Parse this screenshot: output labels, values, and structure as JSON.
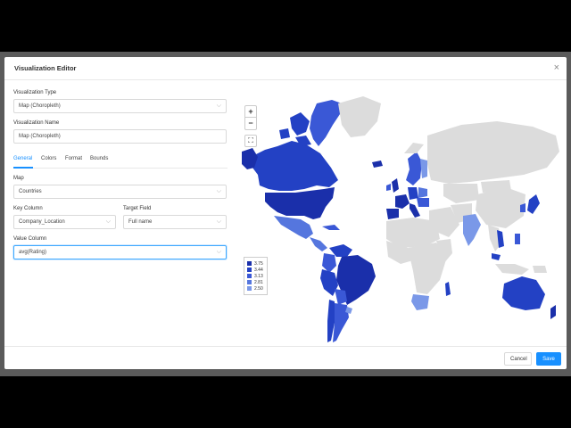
{
  "dialog": {
    "title": "Visualization Editor",
    "close": "×"
  },
  "form": {
    "vis_type_label": "Visualization Type",
    "vis_type_value": "Map (Choropleth)",
    "vis_name_label": "Visualization Name",
    "vis_name_value": "Map (Choropleth)",
    "tabs": [
      "General",
      "Colors",
      "Format",
      "Bounds"
    ],
    "map_label": "Map",
    "map_value": "Countries",
    "key_column_label": "Key Column",
    "key_column_value": "Company_Location",
    "target_field_label": "Target Field",
    "target_field_value": "Full name",
    "value_column_label": "Value Column",
    "value_column_value": "avg(Rating)"
  },
  "map": {
    "zoom_in": "+",
    "zoom_out": "−",
    "fullscreen": "⛶",
    "legend": [
      {
        "label": "3.75",
        "color": "#1a2faa"
      },
      {
        "label": "3.44",
        "color": "#2341c4"
      },
      {
        "label": "3.13",
        "color": "#3a58d6"
      },
      {
        "label": "2.81",
        "color": "#5576de"
      },
      {
        "label": "2.50",
        "color": "#7a98e8"
      }
    ]
  },
  "footer": {
    "cancel": "Cancel",
    "save": "Save"
  },
  "colors": {
    "accent": "#1890ff",
    "land_default": "#dcdcdc"
  }
}
